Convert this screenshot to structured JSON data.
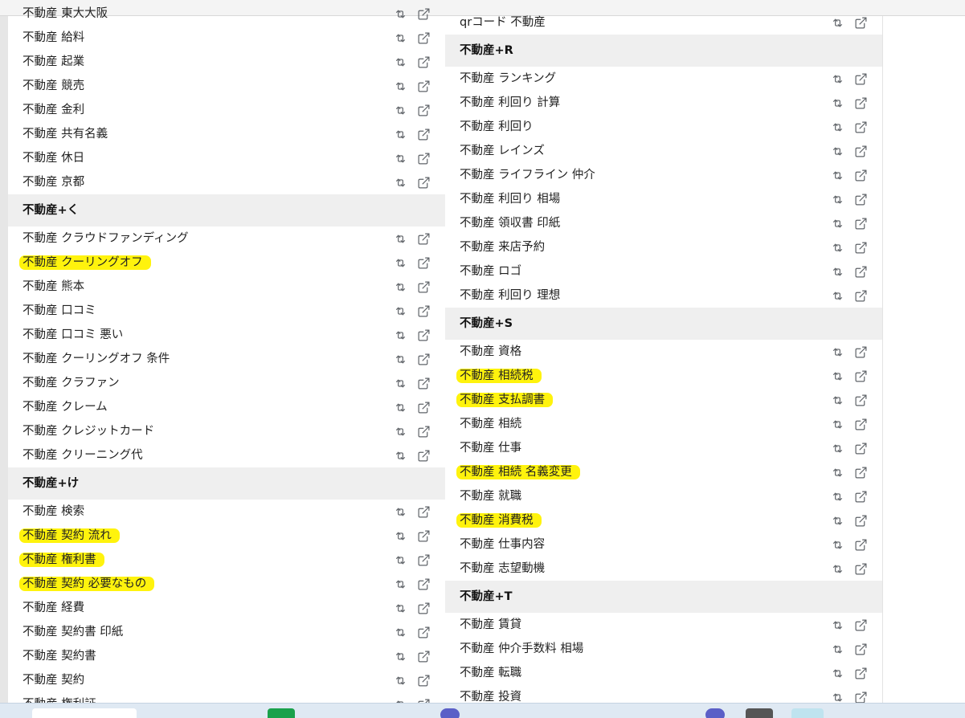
{
  "left_rows": [
    {
      "type": "item",
      "label": "不動産 東大大阪"
    },
    {
      "type": "item",
      "label": "不動産 給料"
    },
    {
      "type": "item",
      "label": "不動産 起業"
    },
    {
      "type": "item",
      "label": "不動産 競売"
    },
    {
      "type": "item",
      "label": "不動産 金利"
    },
    {
      "type": "item",
      "label": "不動産 共有名義"
    },
    {
      "type": "item",
      "label": "不動産 休日"
    },
    {
      "type": "item",
      "label": "不動産 京都"
    },
    {
      "type": "header",
      "label": "不動産+く"
    },
    {
      "type": "item",
      "label": "不動産 クラウドファンディング"
    },
    {
      "type": "item",
      "label": "不動産 クーリングオフ",
      "highlighted": true
    },
    {
      "type": "item",
      "label": "不動産 熊本"
    },
    {
      "type": "item",
      "label": "不動産 口コミ"
    },
    {
      "type": "item",
      "label": "不動産 口コミ 悪い"
    },
    {
      "type": "item",
      "label": "不動産 クーリングオフ 条件"
    },
    {
      "type": "item",
      "label": "不動産 クラファン"
    },
    {
      "type": "item",
      "label": "不動産 クレーム"
    },
    {
      "type": "item",
      "label": "不動産 クレジットカード"
    },
    {
      "type": "item",
      "label": "不動産 クリーニング代"
    },
    {
      "type": "header",
      "label": "不動産+け"
    },
    {
      "type": "item",
      "label": "不動産 検索"
    },
    {
      "type": "item",
      "label": "不動産 契約 流れ",
      "highlighted": true
    },
    {
      "type": "item",
      "label": "不動産 権利書",
      "highlighted": true
    },
    {
      "type": "item",
      "label": "不動産 契約 必要なもの",
      "highlighted": true
    },
    {
      "type": "item",
      "label": "不動産 経費"
    },
    {
      "type": "item",
      "label": "不動産 契約書 印紙"
    },
    {
      "type": "item",
      "label": "不動産 契約書"
    },
    {
      "type": "item",
      "label": "不動産 契約"
    },
    {
      "type": "item",
      "label": "不動産 権利証"
    }
  ],
  "right_rows": [
    {
      "type": "item",
      "label": "qrコード 不動産"
    },
    {
      "type": "header",
      "label": "不動産+R"
    },
    {
      "type": "item",
      "label": "不動産 ランキング"
    },
    {
      "type": "item",
      "label": "不動産 利回り 計算"
    },
    {
      "type": "item",
      "label": "不動産 利回り"
    },
    {
      "type": "item",
      "label": "不動産 レインズ"
    },
    {
      "type": "item",
      "label": "不動産 ライフライン 仲介"
    },
    {
      "type": "item",
      "label": "不動産 利回り 相場"
    },
    {
      "type": "item",
      "label": "不動産 領収書 印紙"
    },
    {
      "type": "item",
      "label": "不動産 来店予約"
    },
    {
      "type": "item",
      "label": "不動産 ロゴ"
    },
    {
      "type": "item",
      "label": "不動産 利回り 理想"
    },
    {
      "type": "header",
      "label": "不動産+S"
    },
    {
      "type": "item",
      "label": "不動産 資格"
    },
    {
      "type": "item",
      "label": "不動産 相続税",
      "highlighted": true
    },
    {
      "type": "item",
      "label": "不動産 支払調書",
      "highlighted": true
    },
    {
      "type": "item",
      "label": "不動産 相続"
    },
    {
      "type": "item",
      "label": "不動産 仕事"
    },
    {
      "type": "item",
      "label": "不動産 相続 名義変更",
      "highlighted": true
    },
    {
      "type": "item",
      "label": "不動産 就職"
    },
    {
      "type": "item",
      "label": "不動産 消費税",
      "highlighted": true
    },
    {
      "type": "item",
      "label": "不動産 仕事内容"
    },
    {
      "type": "item",
      "label": "不動産 志望動機"
    },
    {
      "type": "header",
      "label": "不動産+T"
    },
    {
      "type": "item",
      "label": "不動産 賃貸"
    },
    {
      "type": "item",
      "label": "不動産 仲介手数料 相場"
    },
    {
      "type": "item",
      "label": "不動産 転職"
    },
    {
      "type": "item",
      "label": "不動産 投資"
    }
  ],
  "icons": {
    "search_again": "retweet-icon",
    "open": "external-link-icon"
  },
  "colors": {
    "highlight": "#fff200",
    "header_bg": "#efefef",
    "icon": "#5f6368"
  }
}
